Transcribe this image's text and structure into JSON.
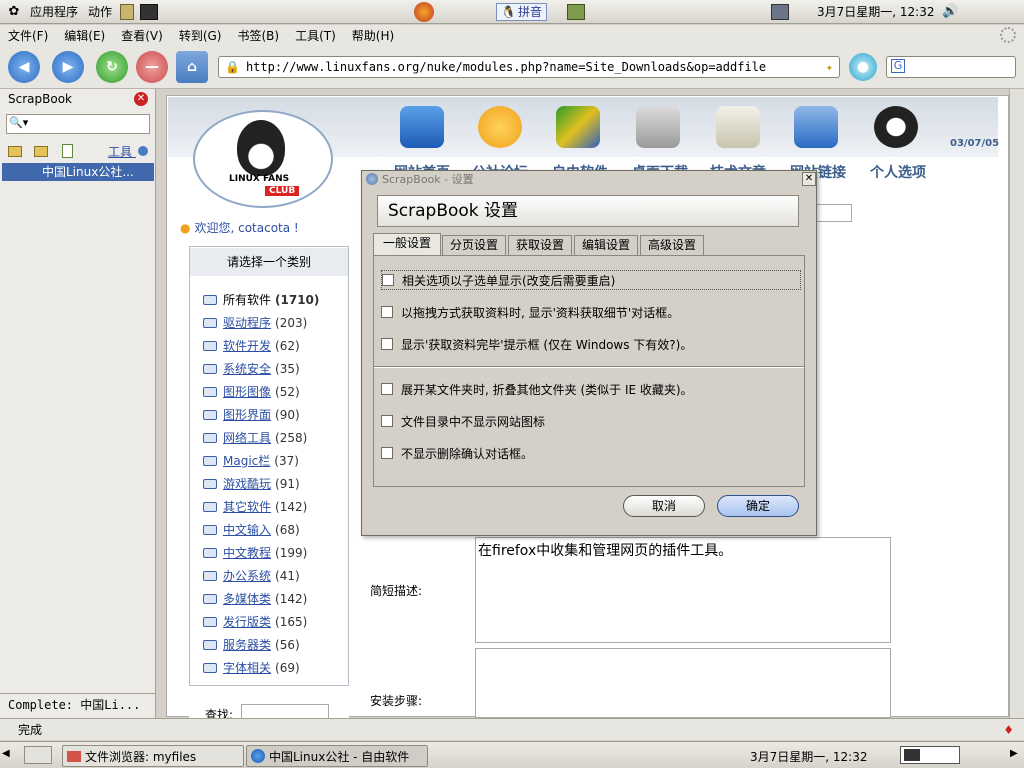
{
  "top_panel": {
    "apps": "应用程序",
    "actions": "动作",
    "ime": "拼音",
    "datetime": "3月7日星期一, 12:32"
  },
  "menubar": [
    "文件(F)",
    "编辑(E)",
    "查看(V)",
    "转到(G)",
    "书签(B)",
    "工具(T)",
    "帮助(H)"
  ],
  "url": "http://www.linuxfans.org/nuke/modules.php?name=Site_Downloads&op=addfile",
  "search_logo": "G",
  "sidebar": {
    "title": "ScrapBook",
    "tools_label": "工具",
    "selected_item": "中国Linux公社...",
    "complete": "Complete: 中国Li..."
  },
  "site": {
    "logo_text": "LINUX FANS",
    "logo_badge": "CLUB",
    "date": "03/07/05",
    "nav": [
      "网站首页",
      "公社论坛",
      "自由软件",
      "桌面下载",
      "技术文章",
      "网站链接",
      "个人选项"
    ],
    "welcome": "欢迎您, cotacota !",
    "category_title": "请选择一个类别",
    "categories": [
      {
        "name": "所有软件",
        "count": "(1710)",
        "bold": true
      },
      {
        "name": "驱动程序",
        "count": "(203)"
      },
      {
        "name": "软件开发",
        "count": "(62)"
      },
      {
        "name": "系统安全",
        "count": "(35)"
      },
      {
        "name": "图形图像",
        "count": "(52)"
      },
      {
        "name": "图形界面",
        "count": "(90)"
      },
      {
        "name": "网络工具",
        "count": "(258)"
      },
      {
        "name": "Magic栏",
        "count": "(37)"
      },
      {
        "name": "游戏酷玩",
        "count": "(91)"
      },
      {
        "name": "其它软件",
        "count": "(142)"
      },
      {
        "name": "中文输入",
        "count": "(68)"
      },
      {
        "name": "中文教程",
        "count": "(199)"
      },
      {
        "name": "办公系统",
        "count": "(41)"
      },
      {
        "name": "多媒体类",
        "count": "(142)"
      },
      {
        "name": "发行版类",
        "count": "(165)"
      },
      {
        "name": "服务器类",
        "count": "(56)"
      },
      {
        "name": "字体相关",
        "count": "(69)"
      }
    ],
    "search_label": "查找:",
    "desc_label": "简短描述:",
    "desc_value": "在firefox中收集和管理网页的插件工具。",
    "steps_label": "安装步骤:"
  },
  "dialog": {
    "window_title": "ScrapBook - 设置",
    "header": "ScrapBook 设置",
    "tabs": [
      "一般设置",
      "分页设置",
      "获取设置",
      "编辑设置",
      "高级设置"
    ],
    "options_group1": [
      "相关选项以子选单显示(改变后需要重启)",
      "以拖拽方式获取资料时, 显示'资料获取细节'对话框。",
      "显示'获取资料完毕'提示框 (仅在 Windows 下有效?)。"
    ],
    "options_group2": [
      "展开某文件夹时, 折叠其他文件夹 (类似于 IE 收藏夹)。",
      "文件目录中不显示网站图标",
      "不显示删除确认对话框。"
    ],
    "cancel": "取消",
    "ok": "确定"
  },
  "status": "完成",
  "taskbar": {
    "task1": "文件浏览器: myfiles",
    "task2": "中国Linux公社 - 自由软件",
    "datetime": "3月7日星期一, 12:32"
  },
  "colors": {
    "selection": "#3f68ad",
    "link": "#2c4fa3",
    "nav_text": "#3c5f8a"
  }
}
